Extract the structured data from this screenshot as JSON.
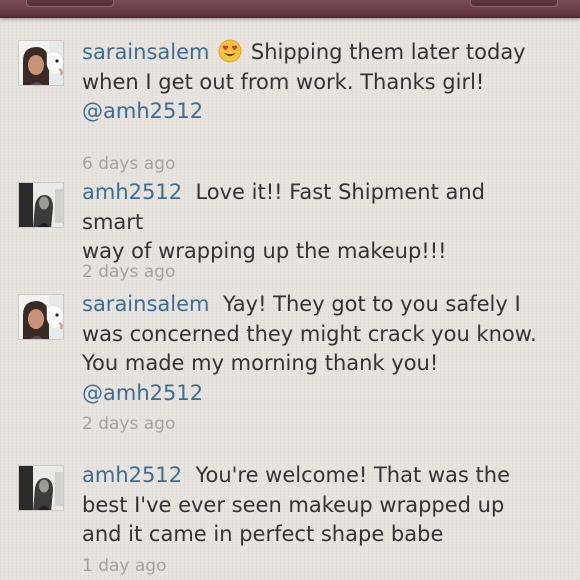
{
  "comments": [
    {
      "username": "sarainsalem",
      "emoji": "heart-eyes-emoji",
      "lines": [
        "Shipping them later today",
        "when I get out from work. Thanks girl!"
      ],
      "mention": "@amh2512",
      "time": "6 days ago"
    },
    {
      "username": "amh2512",
      "lines": [
        "Love it!! Fast Shipment and smart",
        "way of wrapping up the makeup!!!"
      ],
      "time": "2 days ago"
    },
    {
      "username": "sarainsalem",
      "lines": [
        "Yay! They got to you safely I",
        "was concerned they might crack you know.",
        "You made my morning thank you!"
      ],
      "mention": "@amh2512",
      "time": "2 days ago"
    },
    {
      "username": "amh2512",
      "lines": [
        "You're welcome! That was the",
        "best I've ever seen makeup wrapped up",
        "and it came in perfect shape babe"
      ],
      "time": "1 day ago"
    }
  ],
  "colors": {
    "background": "#e6e2dc",
    "topbar": "#5b3038",
    "username": "#3b6e95",
    "text": "#333333",
    "timestamp": "#a6a29d"
  }
}
